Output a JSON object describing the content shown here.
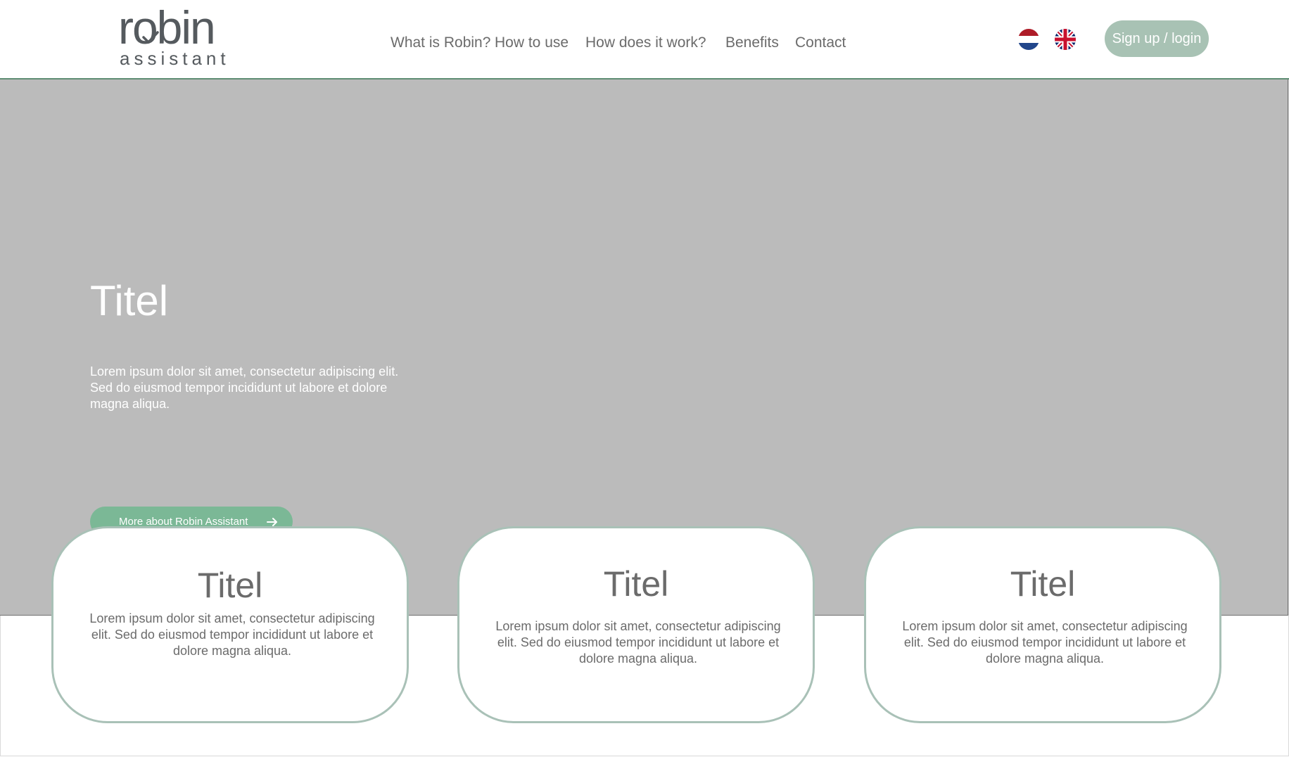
{
  "brand": {
    "logo_word": "robin",
    "logo_sub": "assistant"
  },
  "nav": {
    "items": [
      {
        "label": "What is Robin?"
      },
      {
        "label": "How to use"
      },
      {
        "label": "How does it work?"
      },
      {
        "label": "Benefits"
      },
      {
        "label": "Contact"
      }
    ]
  },
  "language": {
    "flags": [
      "flag-netherlands-icon",
      "flag-uk-icon"
    ]
  },
  "header": {
    "signup_label": "Sign up / login"
  },
  "hero": {
    "title": "Titel",
    "text": "Lorem ipsum dolor sit amet, consectetur adipiscing elit. Sed do eiusmod tempor incididunt ut labore et dolore magna aliqua.",
    "button_label": "More about Robin Assistant",
    "button_icon": "arrow-right-icon"
  },
  "cards": [
    {
      "title": "Titel",
      "text": "Lorem ipsum dolor sit amet, consectetur adipiscing elit. Sed do eiusmod tempor incididunt ut labore et dolore magna aliqua."
    },
    {
      "title": "Titel",
      "text": "Lorem ipsum dolor sit amet, consectetur adipiscing elit. Sed do eiusmod tempor incididunt ut labore et dolore magna aliqua."
    },
    {
      "title": "Titel",
      "text": "Lorem ipsum dolor sit amet, consectetur adipiscing elit. Sed do eiusmod tempor incididunt ut labore et dolore magna aliqua."
    }
  ],
  "colors": {
    "accent_green": "#7bb896",
    "signup_button": "#a8c2b4",
    "card_border": "#a9c1b7",
    "hero_background": "#bbbbbb",
    "text_gray": "#6b6b6b"
  }
}
